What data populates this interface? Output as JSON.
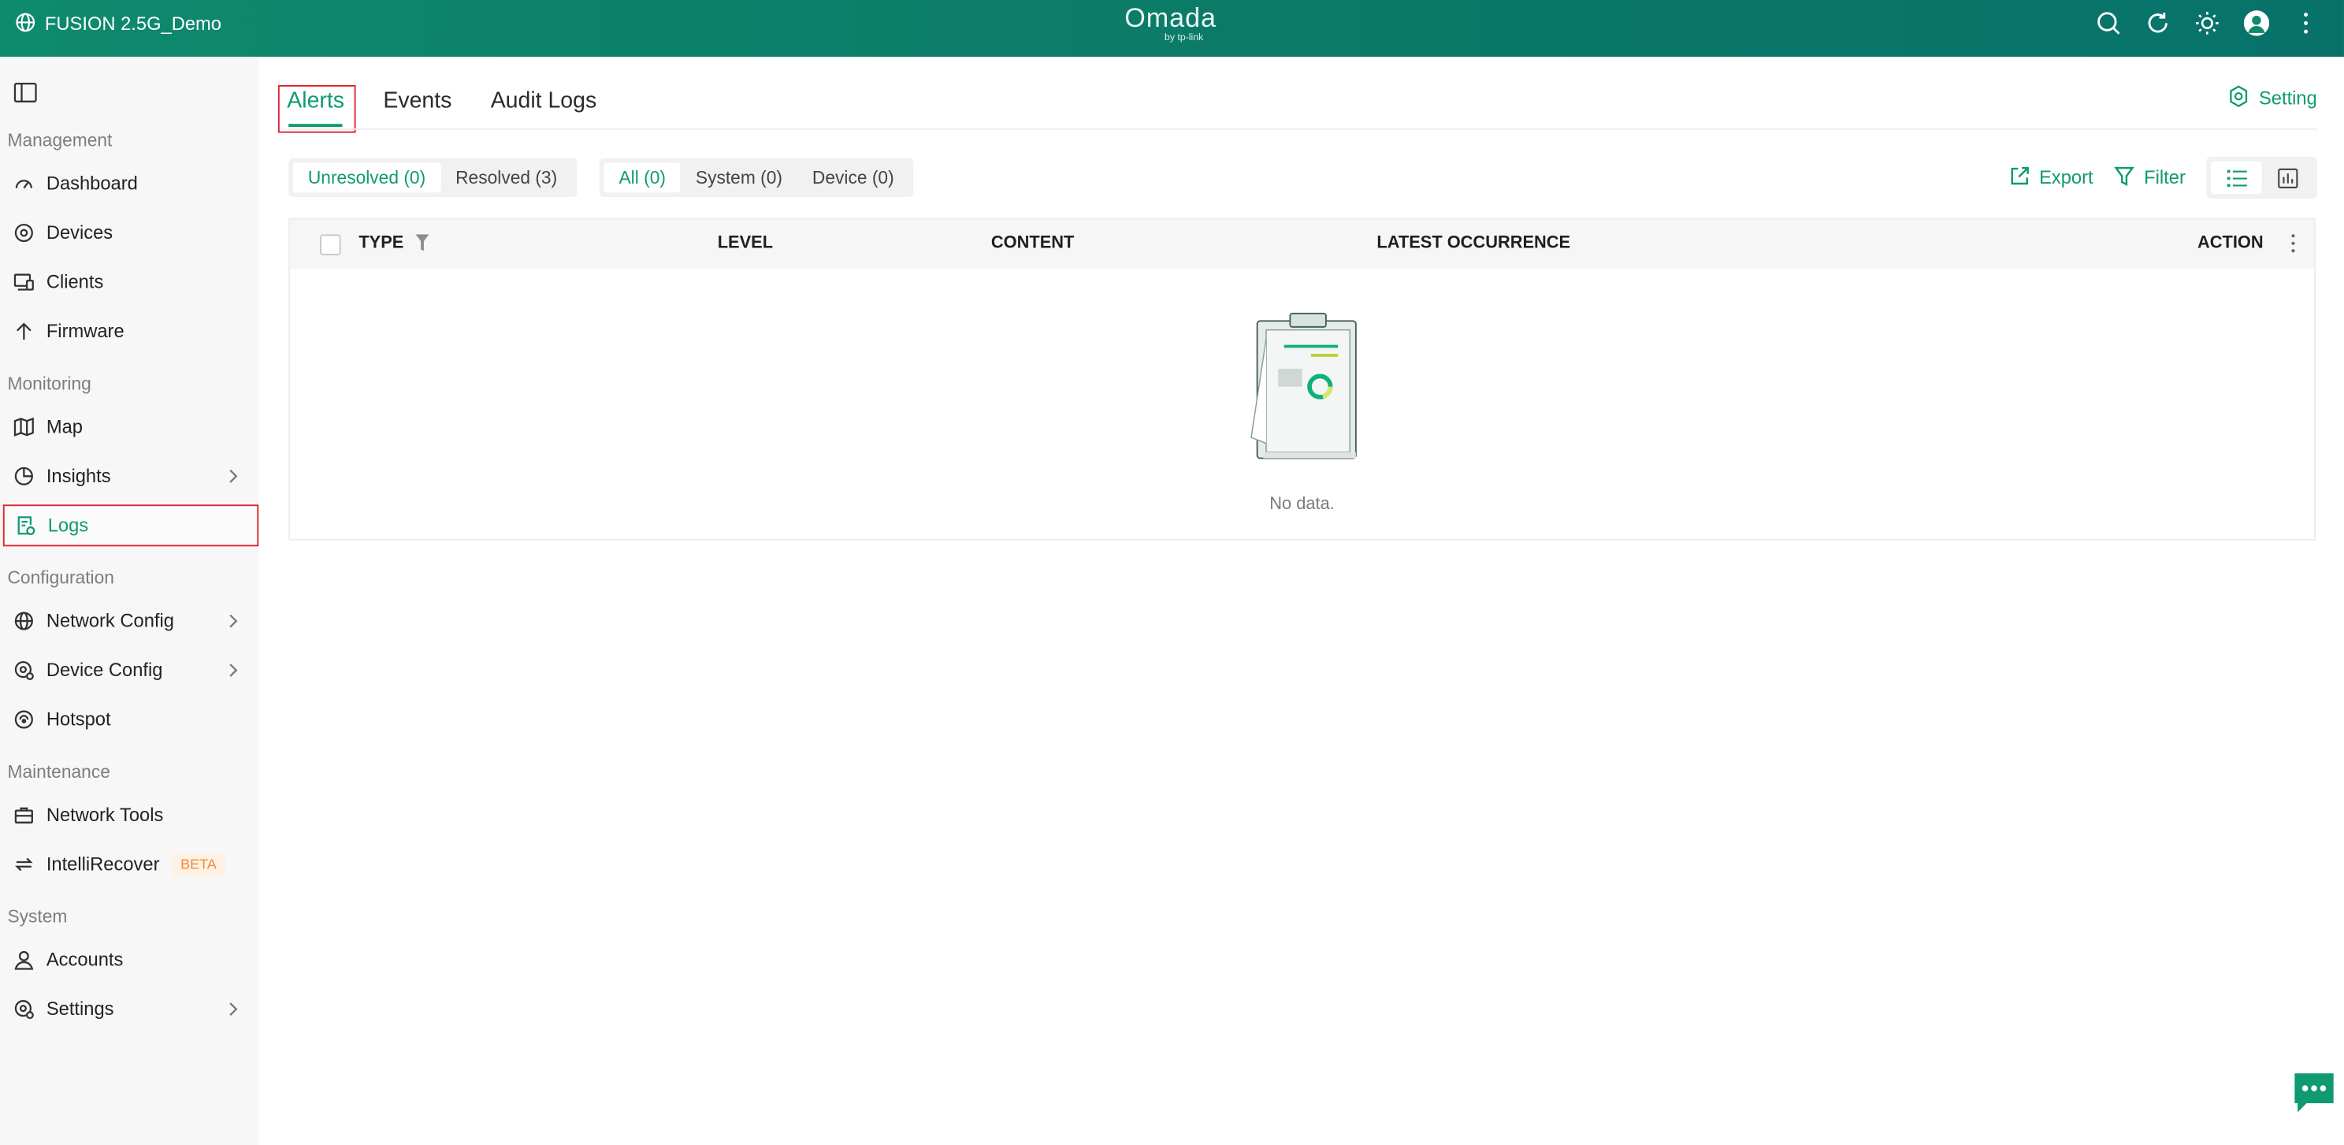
{
  "topbar": {
    "site_name": "FUSION 2.5G_Demo",
    "brand_main": "Omada",
    "brand_sub": "by tp-link",
    "icons": [
      "search-icon",
      "refresh-icon",
      "theme-sun-icon",
      "avatar",
      "more-vertical-icon"
    ]
  },
  "sidebar": {
    "sections": {
      "management": "Management",
      "monitoring": "Monitoring",
      "configuration": "Configuration",
      "maintenance": "Maintenance",
      "system": "System"
    },
    "items": {
      "dashboard": "Dashboard",
      "devices": "Devices",
      "clients": "Clients",
      "firmware": "Firmware",
      "map": "Map",
      "insights": "Insights",
      "logs": "Logs",
      "network_config": "Network Config",
      "device_config": "Device Config",
      "hotspot": "Hotspot",
      "network_tools": "Network Tools",
      "intellirecover": "IntelliRecover",
      "intellirecover_badge": "BETA",
      "accounts": "Accounts",
      "settings": "Settings"
    },
    "active_item": "Logs"
  },
  "main": {
    "tabs": [
      "Alerts",
      "Events",
      "Audit Logs"
    ],
    "active_tab": "Alerts",
    "setting_label": "Setting",
    "status_filter": [
      "Unresolved (0)",
      "Resolved (3)"
    ],
    "status_selected": "Unresolved (0)",
    "type_filter": [
      "All (0)",
      "System (0)",
      "Device (0)"
    ],
    "type_selected": "All (0)",
    "export_label": "Export",
    "filter_label": "Filter",
    "table": {
      "columns": [
        "TYPE",
        "LEVEL",
        "CONTENT",
        "LATEST OCCURRENCE",
        "ACTION"
      ],
      "rows": [],
      "empty_text": "No data."
    }
  },
  "colors": {
    "accent": "#0f9a72",
    "topbar": "#0b7a68",
    "highlight_box": "#e0242b",
    "beta_text": "#ef8a3c"
  }
}
